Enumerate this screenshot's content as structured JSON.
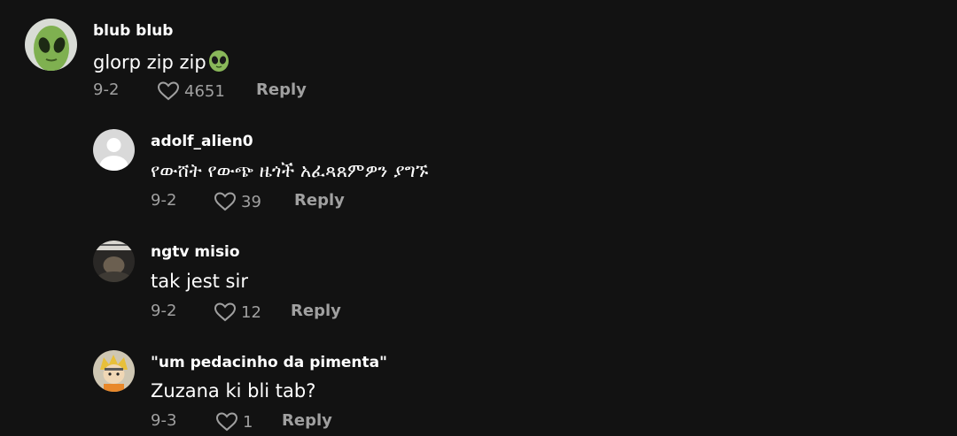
{
  "comments": [
    {
      "username": "blub blub",
      "text": "glorp zip zip",
      "emoji": "alien-face-emoji",
      "date": "9-2",
      "likes": "4651",
      "reply": "Reply"
    },
    {
      "username": "adolf_alien0",
      "text": "የውሸት የውጭ ዜጎች አፈጻጸምዎን ያግኙ",
      "date": "9-2",
      "likes": "39",
      "reply": "Reply"
    },
    {
      "username": "ngtv misio",
      "text": "tak jest sir",
      "date": "9-2",
      "likes": "12",
      "reply": "Reply"
    },
    {
      "username": "\"um pedacinho da pimenta\"",
      "text": "Zuzana ki bli tab?",
      "date": "9-3",
      "likes": "1",
      "reply": "Reply"
    }
  ],
  "colors": {
    "background": "#121212",
    "primary_text": "#ffffff",
    "secondary_text": "#a0a0a0"
  }
}
